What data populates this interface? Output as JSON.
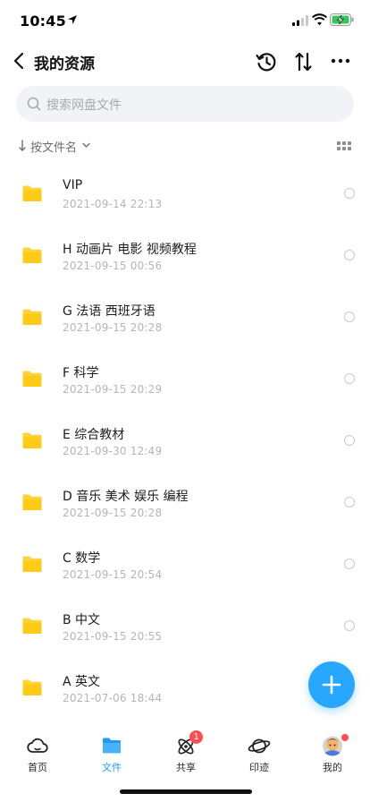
{
  "status_bar": {
    "time": "10:45"
  },
  "header": {
    "title": "我的资源"
  },
  "search": {
    "placeholder": "搜索网盘文件"
  },
  "sort": {
    "label": "按文件名"
  },
  "files": [
    {
      "name": "VIP",
      "date": "2021-09-14 22:13"
    },
    {
      "name": "H 动画片 电影 视频教程",
      "date": "2021-09-15 00:56"
    },
    {
      "name": "G 法语 西班牙语",
      "date": "2021-09-15 20:28"
    },
    {
      "name": "F 科学",
      "date": "2021-09-15 20:29"
    },
    {
      "name": "E 综合教材",
      "date": "2021-09-30 12:49"
    },
    {
      "name": "D 音乐 美术 娱乐 编程",
      "date": "2021-09-15 20:28"
    },
    {
      "name": "C 数学",
      "date": "2021-09-15 20:54"
    },
    {
      "name": "B 中文",
      "date": "2021-09-15 20:55"
    },
    {
      "name": "A 英文",
      "date": "2021-07-06 18:44"
    }
  ],
  "tabs": [
    {
      "label": "首页",
      "icon": "cloud-icon"
    },
    {
      "label": "文件",
      "icon": "folder-icon",
      "active": true
    },
    {
      "label": "共享",
      "icon": "atom-icon",
      "badge": "1"
    },
    {
      "label": "印迹",
      "icon": "planet-icon"
    },
    {
      "label": "我的",
      "icon": "avatar-icon"
    }
  ],
  "colors": {
    "accent": "#1e9bf5",
    "fab": "#27a7ff",
    "folder": "#ffd43a",
    "badge": "#ff4d4f"
  }
}
